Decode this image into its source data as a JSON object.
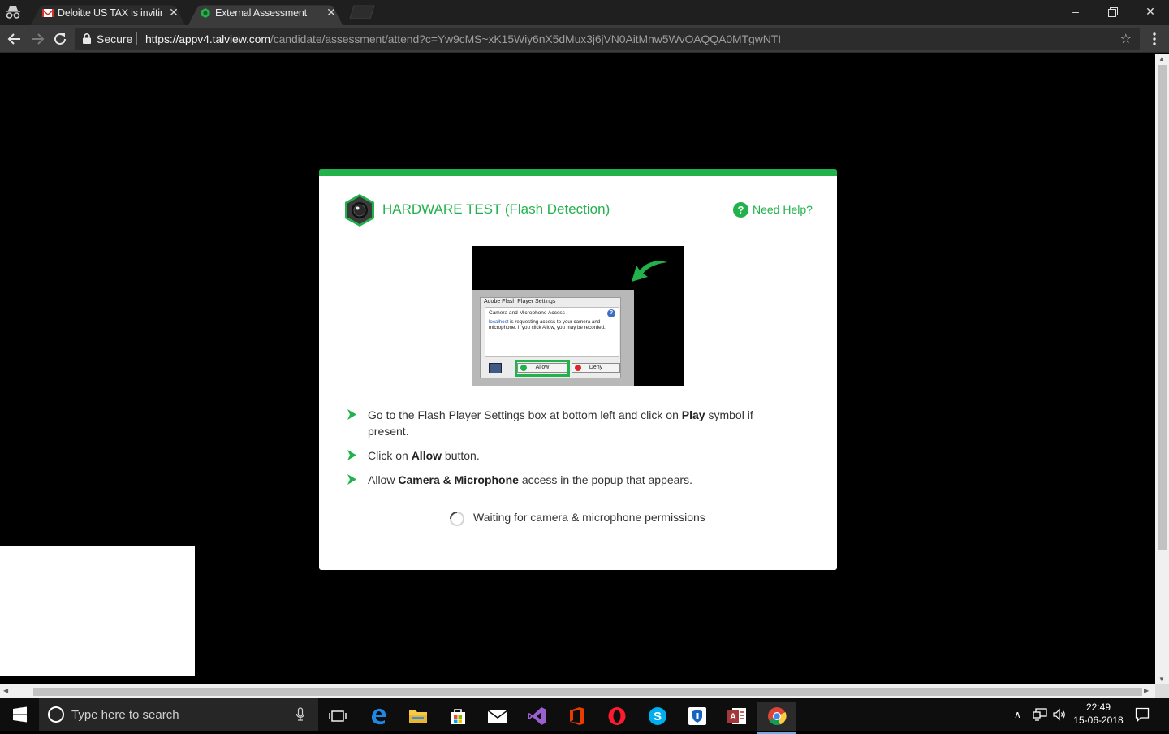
{
  "browser": {
    "tabs": [
      {
        "title": "Deloitte US TAX is inviting you to",
        "active": false
      },
      {
        "title": "External Assessment",
        "active": true
      }
    ],
    "address": {
      "security_label": "Secure",
      "url_host": "https://appv4.talview.com",
      "url_path": "/candidate/assessment/attend?c=Yw9cMS~xK15Wiy6nX5dMux3j6jVN0AitMnw5WvOAQQA0MTgwNTI_"
    }
  },
  "card": {
    "title": "HARDWARE TEST (Flash Detection)",
    "help_label": "Need Help?",
    "illustration": {
      "dialog_title": "Adobe Flash Player Settings",
      "dialog_heading": "Camera and Microphone Access",
      "dialog_link": "localhost",
      "dialog_text": " is requesting access to your camera and microphone. If you click Allow, you may be recorded.",
      "allow_label": "Allow",
      "deny_label": "Deny"
    },
    "steps": [
      {
        "pre": "Go to the Flash Player Settings box at bottom left and click on ",
        "bold": "Play",
        "post": " symbol if present."
      },
      {
        "pre": "Click on ",
        "bold": "Allow",
        "post": " button."
      },
      {
        "pre": "Allow ",
        "bold": "Camera & Microphone",
        "post": " access in the popup that appears."
      }
    ],
    "waiting_text": "Waiting for camera & microphone permissions"
  },
  "taskbar": {
    "search_placeholder": "Type here to search",
    "time": "22:49",
    "date": "15-06-2018",
    "pinned": [
      "task-view-icon",
      "edge-icon",
      "file-explorer-icon",
      "store-icon",
      "mail-icon",
      "visual-studio-icon",
      "office-icon",
      "opera-icon",
      "skype-icon",
      "security-app-icon",
      "access-icon",
      "chrome-icon"
    ]
  },
  "colors": {
    "accent_green": "#22b24c",
    "browser_chrome": "#3b3b3b",
    "page_background": "#000000"
  }
}
